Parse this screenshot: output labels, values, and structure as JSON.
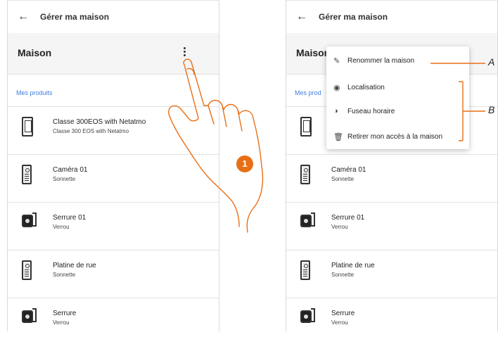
{
  "left_screen": {
    "header_title": "Gérer ma maison",
    "house_name": "Maison",
    "section_label": "Mes produits",
    "products": [
      {
        "name": "Classe 300EOS with Netatmo",
        "type": "Classe 300 EOS with Netatmo",
        "icon": "indoor-screen-icon"
      },
      {
        "name": "Caméra 01",
        "type": "Sonnette",
        "icon": "door-panel-icon"
      },
      {
        "name": "Serrure 01",
        "type": "Verrou",
        "icon": "lock-icon"
      },
      {
        "name": "Platine de rue",
        "type": "Sonnette",
        "icon": "door-panel-icon"
      },
      {
        "name": "Serrure",
        "type": "Verrou",
        "icon": "lock-icon"
      }
    ]
  },
  "right_screen": {
    "header_title": "Gérer ma maison",
    "house_name": "Maison",
    "section_label": "Mes prod",
    "products": [
      {
        "name": "Caméra 01",
        "type": "Sonnette",
        "icon": "door-panel-icon"
      },
      {
        "name": "Serrure 01",
        "type": "Verrou",
        "icon": "lock-icon"
      },
      {
        "name": "Platine de rue",
        "type": "Sonnette",
        "icon": "door-panel-icon"
      },
      {
        "name": "Serrure",
        "type": "Verrou",
        "icon": "lock-icon"
      }
    ],
    "menu": [
      {
        "label": "Renommer la maison",
        "icon": "pencil-icon"
      },
      {
        "label": "Localisation",
        "icon": "location-pin-icon"
      },
      {
        "label": "Fuseau horaire",
        "icon": "globe-icon"
      },
      {
        "label": "Retirer mon accès à la maison",
        "icon": "trash-icon"
      }
    ]
  },
  "annotations": {
    "step": "1",
    "callout_a": "A",
    "callout_b": "B"
  },
  "colors": {
    "accent_link": "#3f7fe0",
    "annotation_orange": "#e96f16"
  }
}
